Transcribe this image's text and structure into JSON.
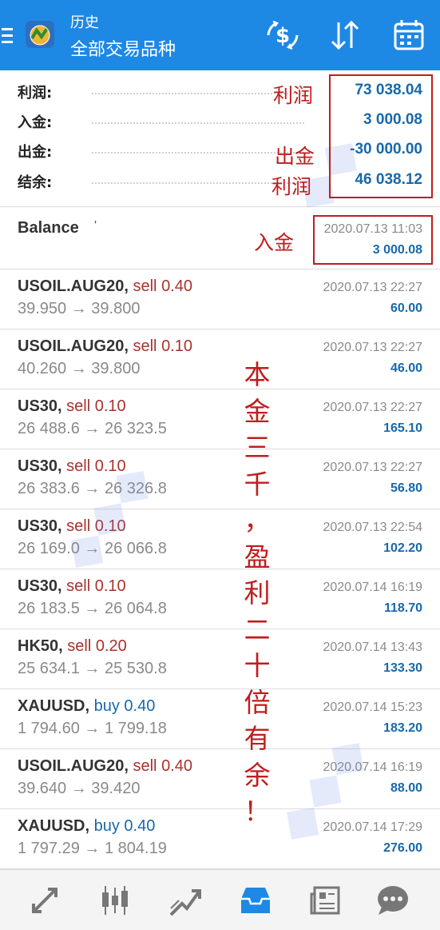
{
  "header": {
    "title": "历史",
    "subtitle": "全部交易品种",
    "menu_icon": "hamburger-menu-icon",
    "logo_icon": "metatrader-logo-icon",
    "actions": [
      "currency-filter-icon",
      "sort-icon",
      "calendar-icon"
    ]
  },
  "summary": {
    "profit_label": "利润:",
    "profit_value": "73 038.04",
    "deposit_label": "入金:",
    "deposit_value": "3 000.08",
    "withdraw_label": "出金:",
    "withdraw_value": "-30 000.00",
    "balance_label": "结余:",
    "balance_value": "46 038.12"
  },
  "balance_entry": {
    "name": "Balance",
    "mark": "'",
    "datetime": "2020.07.13 11:03",
    "amount": "3 000.08"
  },
  "deals": [
    {
      "symbol": "USOIL.AUG20,",
      "side": "sell",
      "volume": "0.40",
      "prices": "39.950 → 39.800",
      "datetime": "2020.07.13 22:27",
      "profit": "60.00"
    },
    {
      "symbol": "USOIL.AUG20,",
      "side": "sell",
      "volume": "0.10",
      "prices": "40.260 → 39.800",
      "datetime": "2020.07.13 22:27",
      "profit": "46.00"
    },
    {
      "symbol": "US30,",
      "side": "sell",
      "volume": "0.10",
      "prices": "26 488.6 → 26 323.5",
      "datetime": "2020.07.13 22:27",
      "profit": "165.10"
    },
    {
      "symbol": "US30,",
      "side": "sell",
      "volume": "0.10",
      "prices": "26 383.6 → 26 326.8",
      "datetime": "2020.07.13 22:27",
      "profit": "56.80"
    },
    {
      "symbol": "US30,",
      "side": "sell",
      "volume": "0.10",
      "prices": "26 169.0 → 26 066.8",
      "datetime": "2020.07.13 22:54",
      "profit": "102.20"
    },
    {
      "symbol": "US30,",
      "side": "sell",
      "volume": "0.10",
      "prices": "26 183.5 → 26 064.8",
      "datetime": "2020.07.14 16:19",
      "profit": "118.70"
    },
    {
      "symbol": "HK50,",
      "side": "sell",
      "volume": "0.20",
      "prices": "25 634.1 → 25 530.8",
      "datetime": "2020.07.14 13:43",
      "profit": "133.30"
    },
    {
      "symbol": "XAUUSD,",
      "side": "buy",
      "volume": "0.40",
      "prices": "1 794.60 → 1 799.18",
      "datetime": "2020.07.14 15:23",
      "profit": "183.20"
    },
    {
      "symbol": "USOIL.AUG20,",
      "side": "sell",
      "volume": "0.40",
      "prices": "39.640 → 39.420",
      "datetime": "2020.07.14 16:19",
      "profit": "88.00"
    },
    {
      "symbol": "XAUUSD,",
      "side": "buy",
      "volume": "0.40",
      "prices": "1 797.29 → 1 804.19",
      "datetime": "2020.07.14 17:29",
      "profit": "276.00"
    }
  ],
  "annotations": {
    "profit_note": "利润",
    "withdraw_note": "出金",
    "balance_profit_note": "利润",
    "deposit_note": "入金",
    "vertical_note": [
      "本",
      "金",
      "三",
      "千",
      "，",
      "盈",
      "利",
      "二",
      "十",
      "倍",
      "有",
      "余",
      "！"
    ],
    "color": "#c01d1d"
  },
  "bottom_nav": [
    "quotes-icon",
    "chart-icon",
    "trade-icon",
    "history-icon",
    "news-icon",
    "chat-icon"
  ],
  "colors": {
    "header_bg": "#1e88e5",
    "value_blue": "#1769aa",
    "sell_red": "#a8322d",
    "active_tab": "#1e88e5"
  }
}
